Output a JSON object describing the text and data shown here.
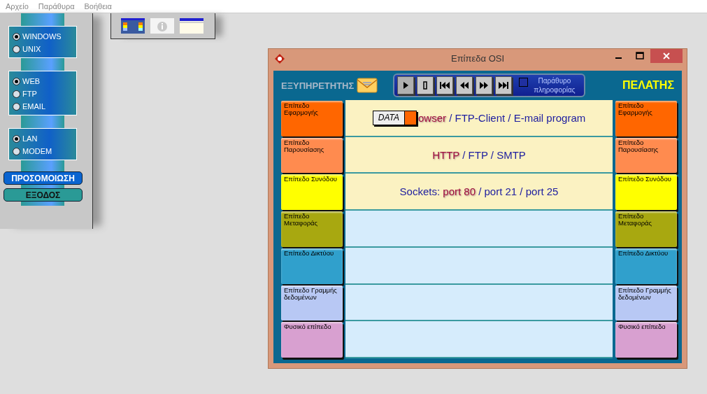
{
  "menu_bar": [
    "Αρχείο",
    "Παράθυρα",
    "Βοήθεια"
  ],
  "options_panel": {
    "groups": [
      {
        "options": [
          {
            "label": "WINDOWS",
            "selected": true
          },
          {
            "label": "UNIX",
            "selected": false
          }
        ]
      },
      {
        "options": [
          {
            "label": "WEB",
            "selected": true
          },
          {
            "label": "FTP",
            "selected": false
          },
          {
            "label": "EMAIL",
            "selected": false
          }
        ]
      },
      {
        "options": [
          {
            "label": "LAN",
            "selected": true
          },
          {
            "label": "MODEM",
            "selected": false
          }
        ]
      }
    ],
    "simulate_button": "ΠΡΟΣΟΜΟΙΩΣΗ",
    "exit_button": "ΕΞΟΔΟΣ"
  },
  "window": {
    "title": "Επίπεδα OSI",
    "server_label": "ΕΞΥΠΗΡΕΤΗΤΗΣ",
    "client_label": "ΠΕΛΑΤΗΣ",
    "info_window_checkbox": {
      "label": "Παράθυρο πληροφορίας",
      "checked": false
    },
    "data_badge": "DATA",
    "layers": [
      {
        "label": "Επίπεδο Εφαρμογής",
        "client_label": "Επίπεδο Εφαρμογής",
        "color": "#ff6600",
        "active": true,
        "protocols": "**owser** / FTP-Client / E-mail program"
      },
      {
        "label": "Επίπεδο Παρουσίασης",
        "client_label": "Επίπεδο Παρουσίασης",
        "color": "#ff8b4f",
        "active": true,
        "protocols": "**HTTP** / FTP / SMTP"
      },
      {
        "label": "Επίπεδο Συνόδου",
        "client_label": "Επίπεδο Συνόδου",
        "color": "#ffff00",
        "active": true,
        "protocols": "Sockets: **port 80** / port 21 / port 25"
      },
      {
        "label": "Επίπεδο Μεταφοράς",
        "client_label": "Επίπεδο Μεταφοράς",
        "color": "#a8a810",
        "active": false
      },
      {
        "label": "Επίπεδο Δικτύου",
        "client_label": "Επίπεδο Δικτύου",
        "color": "#30a0cc",
        "active": false
      },
      {
        "label": "Επίπεδο Γραμμής δεδομένων",
        "client_label": "Επίπεδο Γραμμής δεδομένων",
        "color": "#b8c8f4",
        "active": false
      },
      {
        "label": "Φυσικό επίπεδο",
        "client_label": "Φυσικό επίπεδο",
        "color": "#d8a0d0",
        "active": false
      }
    ]
  }
}
